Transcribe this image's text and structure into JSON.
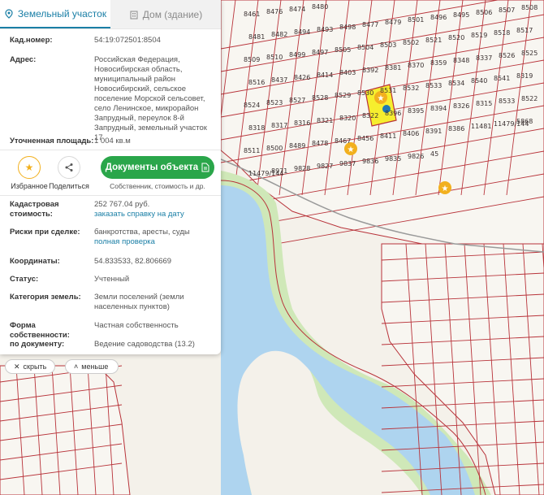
{
  "tabs": {
    "land": "Земельный участок",
    "building": "Дом (здание)"
  },
  "fields": {
    "cadnum_label": "Кад.номер:",
    "cadnum_value": "54:19:072501:8504",
    "address_label": "Адрес:",
    "address_value": "Российская Федерация, Новосибирская область, муниципальный район Новосибирский, сельское поселение Морской сельсовет, село Ленинское, микрорайон Запрудный, переулок 8-й Запрудный, земельный участок 17",
    "area_label": "Уточненная площадь:",
    "area_value": "1 004 кв.м",
    "cost_label": "Кадастровая стоимость:",
    "cost_value": "252 767.04 руб.",
    "cost_link": "заказать справку на дату",
    "risks_label": "Риски при сделке:",
    "risks_value": "банкротства, аресты, суды",
    "risks_link": "полная проверка",
    "coords_label": "Координаты:",
    "coords_value": "54.833533, 82.806669",
    "status_label": "Статус:",
    "status_value": "Учтенный",
    "category_label": "Категория земель:",
    "category_value": "Земли поселений (земли населенных пунктов)",
    "ownership_label": "Форма собственности:",
    "ownership_value": "Частная собственность",
    "document_label": "по документу:",
    "document_value": "Ведение садоводства (13.2)"
  },
  "actions": {
    "favorite": "Избранное",
    "share": "Поделиться",
    "documents": "Документы объекта",
    "documents_sub": "Собственник, стоимость и др."
  },
  "controls": {
    "hide": "скрыть",
    "less": "меньше"
  },
  "map": {
    "colors": {
      "parcel_border": "#b8333a",
      "water": "#aed4ef",
      "greenery": "#cfe8b8",
      "selected": "#f6ee2e",
      "marker": "#1f78b4",
      "star": "#f2b01e"
    },
    "labels": [
      "8461",
      "8476",
      "8474",
      "8480",
      "8481",
      "8482",
      "8494",
      "8493",
      "8498",
      "8477",
      "8479",
      "8501",
      "8496",
      "8495",
      "8506",
      "8507",
      "8508",
      "8509",
      "8510",
      "8499",
      "8497",
      "8505",
      "8504",
      "8503",
      "8502",
      "8521",
      "8520",
      "8519",
      "8518",
      "8517",
      "8516",
      "8437",
      "8426",
      "8414",
      "8403",
      "8392",
      "8381",
      "8370",
      "8359",
      "8348",
      "8337",
      "8526",
      "8525",
      "8524",
      "8523",
      "8527",
      "8528",
      "8529",
      "8530",
      "8531",
      "8532",
      "8533",
      "8534",
      "8540",
      "8541",
      "8319",
      "8318",
      "8317",
      "8316",
      "8321",
      "8320",
      "8322",
      "8396",
      "8395",
      "8394",
      "8326",
      "8315",
      "8533",
      "8522",
      "8511",
      "8500",
      "8489",
      "8478",
      "8467",
      "8456",
      "8411",
      "8406",
      "8391",
      "8386",
      "11481",
      "11479/144",
      "5868",
      "11479/144",
      "8971",
      "9828",
      "9827",
      "9837",
      "9836",
      "9835",
      "9826",
      "45"
    ]
  }
}
